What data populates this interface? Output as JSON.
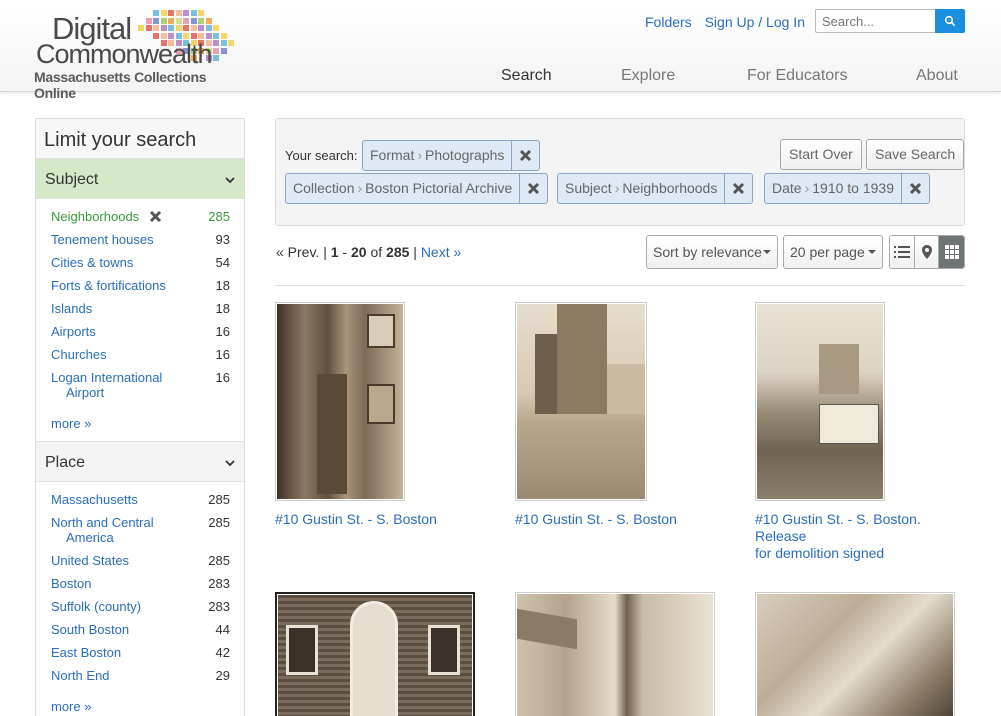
{
  "header": {
    "logo_line1": "Digital",
    "logo_line2": "Commonwealth",
    "logo_line3": "Massachusetts Collections Online",
    "links": [
      "Folders",
      "Sign Up / Log In"
    ],
    "search_placeholder": "Search...",
    "nav": [
      {
        "label": "Search",
        "active": true
      },
      {
        "label": "Explore",
        "active": false
      },
      {
        "label": "For Educators",
        "active": false
      },
      {
        "label": "About",
        "active": false
      }
    ]
  },
  "sidebar": {
    "title": "Limit your search",
    "subject": {
      "heading": "Subject",
      "items": [
        {
          "label": "Neighborhoods",
          "count": "285",
          "selected": true
        },
        {
          "label": "Tenement houses",
          "count": "93"
        },
        {
          "label": "Cities & towns",
          "count": "54"
        },
        {
          "label": "Forts & fortifications",
          "count": "18"
        },
        {
          "label": "Islands",
          "count": "18"
        },
        {
          "label": "Airports",
          "count": "16"
        },
        {
          "label": "Churches",
          "count": "16"
        },
        {
          "label": "Logan International",
          "label2": "Airport",
          "count": "16"
        }
      ],
      "more": "more »"
    },
    "place": {
      "heading": "Place",
      "items": [
        {
          "label": "Massachusetts",
          "count": "285"
        },
        {
          "label": "North and Central",
          "label2": "America",
          "count": "285"
        },
        {
          "label": "United States",
          "count": "285"
        },
        {
          "label": "Boston",
          "count": "283"
        },
        {
          "label": "Suffolk (county)",
          "count": "283"
        },
        {
          "label": "South Boston",
          "count": "44"
        },
        {
          "label": "East Boston",
          "count": "42"
        },
        {
          "label": "North End",
          "count": "29"
        }
      ],
      "more": "more »"
    }
  },
  "constraints": {
    "label": "Your search:",
    "chips": [
      {
        "field": "Format",
        "value": "Photographs"
      },
      {
        "field": "Collection",
        "value": "Boston Pictorial Archive"
      },
      {
        "field": "Subject",
        "value": "Neighborhoods"
      },
      {
        "field": "Date",
        "value": "1910 to 1939"
      }
    ],
    "start_over": "Start Over",
    "save_search": "Save Search"
  },
  "pager": {
    "prev": "« Prev.",
    "range_start": "1",
    "range_end": "20",
    "of": "of",
    "total": "285",
    "next": "Next »"
  },
  "sort": {
    "sort_label": "Sort by relevance",
    "per_page_label": "20 per page",
    "view_modes": [
      "list-view-icon",
      "map-view-icon",
      "gallery-view-icon"
    ],
    "active_view": "gallery"
  },
  "results": [
    {
      "title": "#10 Gustin St. - S. Boston"
    },
    {
      "title": "#10 Gustin St. - S. Boston"
    },
    {
      "title": "#10 Gustin St. - S. Boston. Release",
      "title2": "for demolition signed"
    },
    {
      "title": ""
    },
    {
      "title": ""
    },
    {
      "title": ""
    }
  ],
  "colors": {
    "accent": "#2a6ebb",
    "search_button": "#1a8fe0",
    "selected_facet": "#3a9a3a",
    "facet_header_active": "#d5e8c8"
  }
}
